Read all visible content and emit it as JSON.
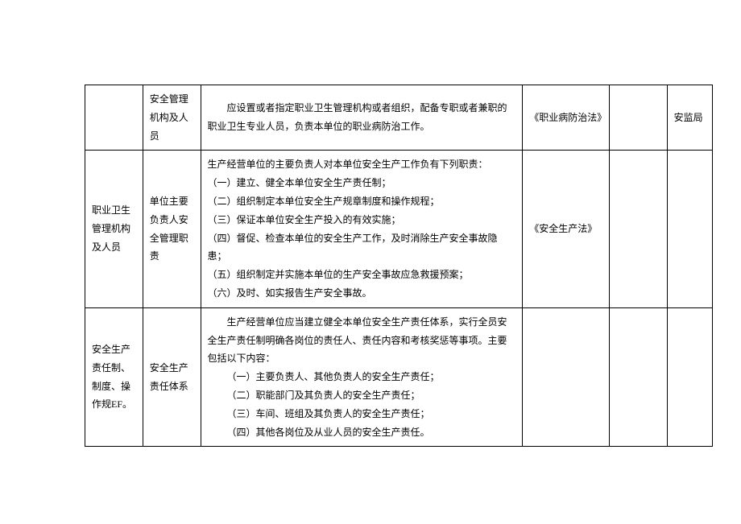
{
  "rows": [
    {
      "c1": "",
      "c2": "安全管理机构及人员",
      "c3_indent": "应设置或者指定职业卫生管理机构或者组织，配备专职或者兼职的职业卫生专业人员，负责本单位的职业病防治工作。",
      "c4": "《职业病防治法》",
      "c5": "",
      "c6": "安监局"
    },
    {
      "c1": "职业卫生管理机构及人员",
      "c2": "单位主要负责人安全管理职责",
      "c3_lines": [
        "生产经营单位的主要负责人对本单位安全生产工作负有下列职责：",
        "（一）建立、健全本单位安全生产责任制；",
        "（二）组织制定本单位安全生产规章制度和操作规程；",
        "（三）保证本单位安全生产投入的有效实施；",
        "（四）督促、检查本单位的安全生产工作，及时消除生产安全事故隐患；",
        "（五）组织制定并实施本单位的生产安全事故应急救援预案；",
        "（六）及时、如实报告生产安全事故。"
      ],
      "c4": "《安全生产法》",
      "c5": "",
      "c6": ""
    },
    {
      "c1": "安全生产责任制、制度、操作规",
      "c1_suffix": "EF。",
      "c2": "安全生产责任体系",
      "c3_intro": "生产经营单位应当建立健全本单位安全生产责任体系，实行全员安全生产责任制明确各岗位的责任人、责任内容和考核奖惩等事项。主要包括以下内容：",
      "c3_items": [
        "（一）主要负责人、其他负责人的安全生产责任；",
        "（二）职能部门及其负责人的安全生产责任；",
        "（三）车间、班组及其负责人的安全生产责任；",
        "（四）其他各岗位及从业人员的安全生产责任。"
      ],
      "c4": "",
      "c5": "",
      "c6": ""
    }
  ]
}
